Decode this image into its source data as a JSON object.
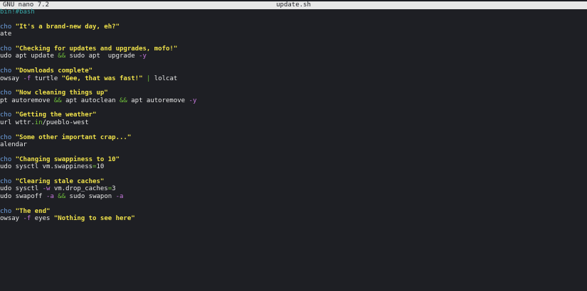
{
  "titlebar": {
    "app": "GNU nano 7.2",
    "filename": "update.sh"
  },
  "lines": [
    [
      {
        "t": "bin!#bash",
        "c": "comment"
      }
    ],
    [],
    [
      {
        "t": "cho ",
        "c": "kw"
      },
      {
        "t": "\"It's a brand-new day, eh?\"",
        "c": "str"
      }
    ],
    [
      {
        "t": "ate",
        "c": "plain"
      }
    ],
    [],
    [
      {
        "t": "cho ",
        "c": "kw"
      },
      {
        "t": "\"Checking for updates and upgrades, mofo!\"",
        "c": "str"
      }
    ],
    [
      {
        "t": "udo apt update ",
        "c": "plain"
      },
      {
        "t": "&&",
        "c": "op"
      },
      {
        "t": " sudo apt  upgrade ",
        "c": "plain"
      },
      {
        "t": "-y",
        "c": "flag"
      }
    ],
    [],
    [
      {
        "t": "cho ",
        "c": "kw"
      },
      {
        "t": "\"Downloads complete\"",
        "c": "str"
      }
    ],
    [
      {
        "t": "owsay ",
        "c": "plain"
      },
      {
        "t": "-f",
        "c": "flag"
      },
      {
        "t": " turtle ",
        "c": "plain"
      },
      {
        "t": "\"Gee, that was fast!\"",
        "c": "str"
      },
      {
        "t": " ",
        "c": "plain"
      },
      {
        "t": "|",
        "c": "op"
      },
      {
        "t": " lolcat",
        "c": "plain"
      }
    ],
    [],
    [
      {
        "t": "cho ",
        "c": "kw"
      },
      {
        "t": "\"Now cleaning things up\"",
        "c": "str"
      }
    ],
    [
      {
        "t": "pt autoremove ",
        "c": "plain"
      },
      {
        "t": "&&",
        "c": "op"
      },
      {
        "t": " apt autoclean ",
        "c": "plain"
      },
      {
        "t": "&&",
        "c": "op"
      },
      {
        "t": " apt autoremove ",
        "c": "plain"
      },
      {
        "t": "-y",
        "c": "flag"
      }
    ],
    [],
    [
      {
        "t": "cho ",
        "c": "kw"
      },
      {
        "t": "\"Getting the weather\"",
        "c": "str"
      }
    ],
    [
      {
        "t": "url wttr.",
        "c": "plain"
      },
      {
        "t": "in",
        "c": "op"
      },
      {
        "t": "/pueblo-west",
        "c": "plain"
      }
    ],
    [],
    [
      {
        "t": "cho ",
        "c": "kw"
      },
      {
        "t": "\"Some other important crap...\"",
        "c": "str"
      }
    ],
    [
      {
        "t": "alendar",
        "c": "plain"
      }
    ],
    [],
    [
      {
        "t": "cho ",
        "c": "kw"
      },
      {
        "t": "\"Changing swappiness to 10\"",
        "c": "str"
      }
    ],
    [
      {
        "t": "udo sysctl vm.swappiness",
        "c": "plain"
      },
      {
        "t": "=",
        "c": "op"
      },
      {
        "t": "10",
        "c": "plain"
      }
    ],
    [],
    [
      {
        "t": "cho ",
        "c": "kw"
      },
      {
        "t": "\"Clearing stale caches\"",
        "c": "str"
      }
    ],
    [
      {
        "t": "udo sysctl ",
        "c": "plain"
      },
      {
        "t": "-w",
        "c": "flag"
      },
      {
        "t": " vm.drop_caches",
        "c": "plain"
      },
      {
        "t": "=",
        "c": "op"
      },
      {
        "t": "3",
        "c": "plain"
      }
    ],
    [
      {
        "t": "udo swapoff ",
        "c": "plain"
      },
      {
        "t": "-a",
        "c": "flag"
      },
      {
        "t": " ",
        "c": "plain"
      },
      {
        "t": "&&",
        "c": "op"
      },
      {
        "t": " sudo swapon ",
        "c": "plain"
      },
      {
        "t": "-a",
        "c": "flag"
      }
    ],
    [],
    [
      {
        "t": "cho ",
        "c": "kw"
      },
      {
        "t": "\"The end\"",
        "c": "str"
      }
    ],
    [
      {
        "t": "owsay ",
        "c": "plain"
      },
      {
        "t": "-f",
        "c": "flag"
      },
      {
        "t": " eyes ",
        "c": "plain"
      },
      {
        "t": "\"Nothing to see here\"",
        "c": "str"
      }
    ]
  ]
}
